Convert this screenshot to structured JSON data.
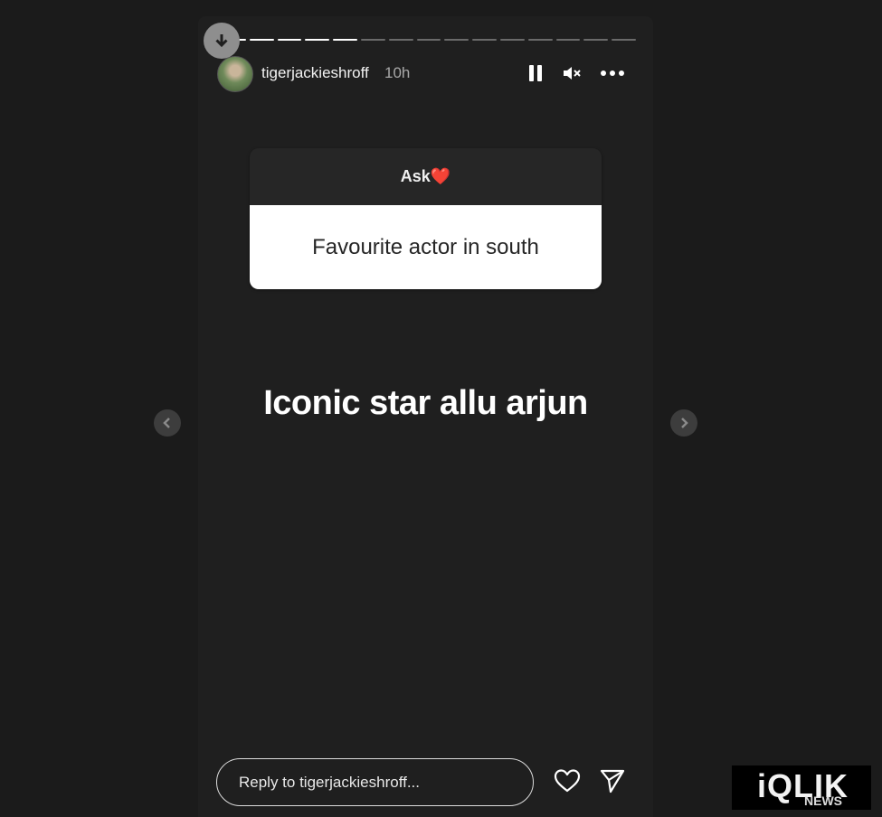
{
  "story": {
    "username": "tigerjackieshroff",
    "time_ago": "10h",
    "progress": {
      "segments": 15,
      "completed": 5
    },
    "question_box": {
      "header": "Ask❤️",
      "question": "Favourite actor in south"
    },
    "answer_text": "Iconic star allu arjun"
  },
  "controls": {
    "download_icon": "download-arrow-icon",
    "pause_icon": "pause-icon",
    "mute_icon": "muted-speaker-icon",
    "more_icon": "more-horizontal-icon",
    "prev_icon": "chevron-left-icon",
    "next_icon": "chevron-right-icon"
  },
  "footer": {
    "reply_placeholder": "Reply to tigerjackieshroff...",
    "like_icon": "heart-icon",
    "share_icon": "send-icon"
  },
  "watermark": {
    "brand": "iQLIK",
    "sub": "NEWS"
  },
  "colors": {
    "background": "#1b1b1b",
    "story_bg": "#1f1f1f",
    "text": "#ffffff"
  }
}
